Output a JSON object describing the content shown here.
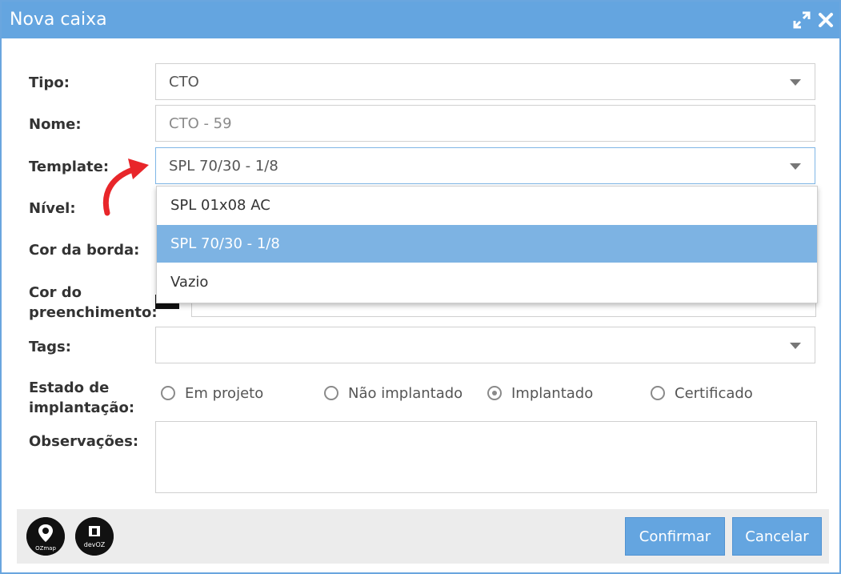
{
  "window": {
    "title": "Nova caixa"
  },
  "form": {
    "tipo": {
      "label": "Tipo:",
      "value": "CTO"
    },
    "nome": {
      "label": "Nome:",
      "placeholder": "CTO - 59"
    },
    "template": {
      "label": "Template:",
      "value": "SPL 70/30 - 1/8"
    },
    "nivel": {
      "label": "Nível:"
    },
    "cor_borda": {
      "label": "Cor da borda:"
    },
    "cor_preenchimento": {
      "label_line1": "Cor do",
      "label_line2": "preenchimento:"
    },
    "tags": {
      "label": "Tags:"
    },
    "estado": {
      "label_line1": "Estado de",
      "label_line2": "implantação:",
      "options": [
        "Em projeto",
        "Não implantado",
        "Implantado",
        "Certificado"
      ],
      "selected": "Implantado"
    },
    "observacoes": {
      "label": "Observações:"
    }
  },
  "template_dropdown": {
    "options": [
      "SPL 01x08 AC",
      "SPL 70/30 - 1/8",
      "Vazio"
    ],
    "selected": "SPL 70/30 - 1/8"
  },
  "footer": {
    "logos": [
      "OZmap",
      "devOZ"
    ],
    "confirm_label": "Confirmar",
    "cancel_label": "Cancelar"
  },
  "colors": {
    "accent": "#64a5e0",
    "selected_option": "#7db3e3",
    "annotation_arrow": "#e8262a"
  }
}
